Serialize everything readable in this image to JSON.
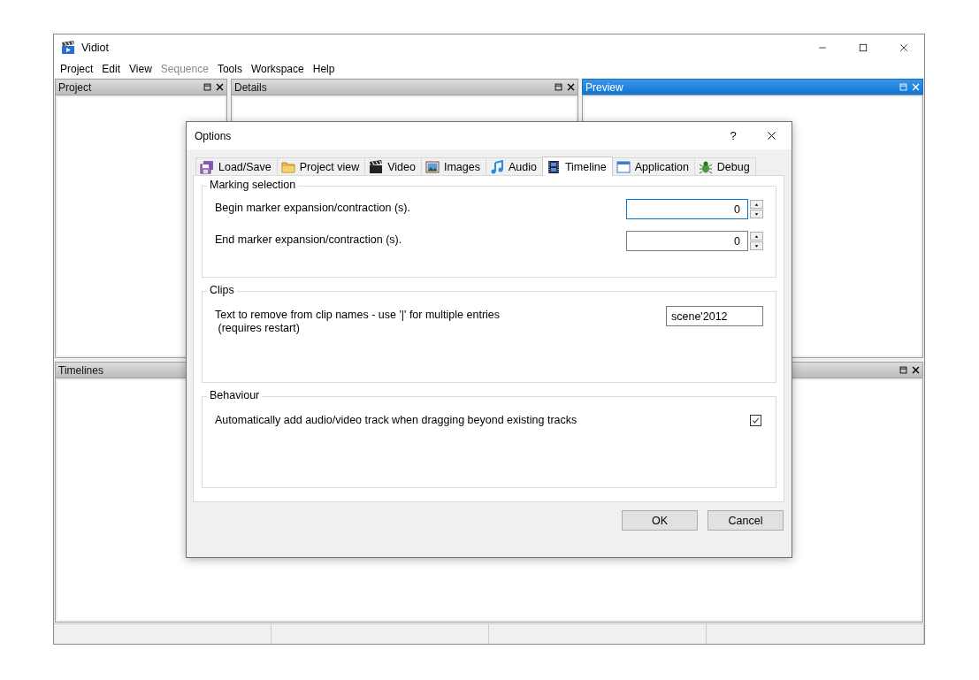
{
  "window": {
    "title": "Vidiot"
  },
  "menu": [
    {
      "label": "Project",
      "disabled": false
    },
    {
      "label": "Edit",
      "disabled": false
    },
    {
      "label": "View",
      "disabled": false
    },
    {
      "label": "Sequence",
      "disabled": true
    },
    {
      "label": "Tools",
      "disabled": false
    },
    {
      "label": "Workspace",
      "disabled": false
    },
    {
      "label": "Help",
      "disabled": false
    }
  ],
  "panes": [
    {
      "title": "Project",
      "active": false
    },
    {
      "title": "Details",
      "active": false
    },
    {
      "title": "Preview",
      "active": true
    }
  ],
  "timelines_pane": {
    "title": "Timelines",
    "active": false
  },
  "dialog": {
    "title": "Options",
    "help": "?",
    "tabs": [
      {
        "label": "Load/Save",
        "selected": false
      },
      {
        "label": "Project view",
        "selected": false
      },
      {
        "label": "Video",
        "selected": false
      },
      {
        "label": "Images",
        "selected": false
      },
      {
        "label": "Audio",
        "selected": false
      },
      {
        "label": "Timeline",
        "selected": true
      },
      {
        "label": "Application",
        "selected": false
      },
      {
        "label": "Debug",
        "selected": false
      }
    ],
    "groups": [
      {
        "title": "Marking selection",
        "rows": [
          {
            "kind": "spin",
            "label": "Begin marker expansion/contraction (s).",
            "value": "0",
            "focused": true
          },
          {
            "kind": "spin",
            "label": "End marker expansion/contraction (s).",
            "value": "0",
            "focused": false
          }
        ]
      },
      {
        "title": "Clips",
        "rows": [
          {
            "kind": "text",
            "label": "Text to remove from clip names - use '|' for multiple entries",
            "note": " (requires restart)",
            "value": "scene'2012"
          }
        ]
      },
      {
        "title": "Behaviour",
        "rows": [
          {
            "kind": "check",
            "label": "Automatically add audio/video track when dragging beyond existing tracks",
            "checked": true
          }
        ]
      }
    ],
    "buttons": [
      "OK",
      "Cancel"
    ]
  }
}
